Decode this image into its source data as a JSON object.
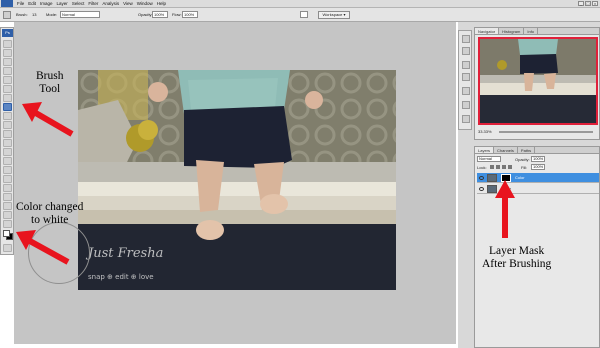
{
  "menubar": {
    "logo": "Ps",
    "items": [
      "File",
      "Edit",
      "Image",
      "Layer",
      "Select",
      "Filter",
      "Analysis",
      "View",
      "Window",
      "Help"
    ],
    "window_controls": [
      "_",
      "□",
      "×"
    ]
  },
  "options_bar": {
    "brush_label": "Brush:",
    "brush_size": "13",
    "mode_label": "Mode:",
    "mode_value": "Normal",
    "opacity_label": "Opacity:",
    "opacity_value": "100%",
    "flow_label": "Flow:",
    "flow_value": "100%",
    "workspace_label": "Workspace ▾"
  },
  "toolbox": {
    "logo": "Ps",
    "active_tool": "brush-tool",
    "foreground_color": "#ffffff",
    "background_color": "#000000"
  },
  "photo": {
    "watermark_script": "Just Fresha",
    "watermark_tagline": "snap ⊕ edit ⊕ love"
  },
  "navigator_panel": {
    "tabs": [
      "Navigator",
      "Histogram",
      "Info"
    ],
    "zoom": "33.33%",
    "view_box_color": "#e0203a"
  },
  "layers_panel": {
    "tabs": [
      "Layers",
      "Channels",
      "Paths"
    ],
    "blend_mode": "Normal",
    "opacity_label": "Opacity:",
    "opacity_value": "100%",
    "lock_label": "Lock:",
    "fill_label": "Fill:",
    "fill_value": "100%",
    "layers": [
      {
        "name": "Color",
        "selected": true,
        "has_mask": true
      },
      {
        "name": "Layer",
        "selected": false,
        "has_mask": false
      }
    ],
    "selected_color": "#3f8fe0"
  },
  "annotations": {
    "brush_tool": [
      "Brush",
      "Tool"
    ],
    "color_changed": [
      "Color changed",
      "to white"
    ],
    "layer_mask": [
      "Layer Mask",
      "After Brushing"
    ],
    "arrow_color": "#e8141e"
  }
}
